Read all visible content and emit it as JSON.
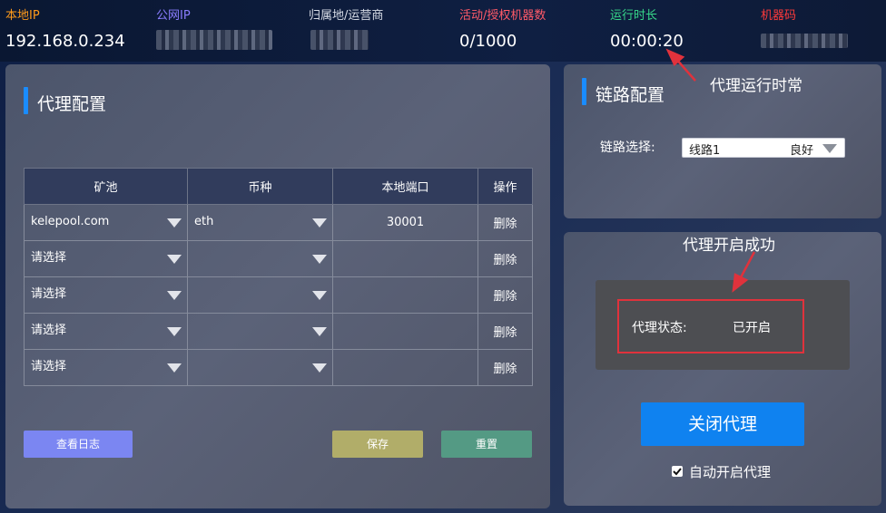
{
  "topbar": {
    "local_ip_label": "本地IP",
    "local_ip_value": "192.168.0.234",
    "public_ip_label": "公网IP",
    "location_label": "归属地/运营商",
    "machines_label": "活动/授权机器数",
    "machines_value": "0/1000",
    "uptime_label": "运行时长",
    "uptime_value": "00:00:20",
    "machine_code_label": "机器码",
    "colors": {
      "local_ip": "#ff9a1a",
      "public_ip": "#8a7dff",
      "location": "#d6dbe6",
      "machines": "#ff5a68",
      "uptime": "#37d98a",
      "machine_code": "#ff3a3a"
    }
  },
  "proxy_config": {
    "title": "代理配置",
    "columns": [
      "矿池",
      "币种",
      "本地端口",
      "操作"
    ],
    "rows": [
      {
        "pool": "kelepool.com",
        "coin": "eth",
        "port": "30001",
        "action": "删除"
      },
      {
        "pool": "请选择",
        "coin": "",
        "port": "",
        "action": "删除"
      },
      {
        "pool": "请选择",
        "coin": "",
        "port": "",
        "action": "删除"
      },
      {
        "pool": "请选择",
        "coin": "",
        "port": "",
        "action": "删除"
      },
      {
        "pool": "请选择",
        "coin": "",
        "port": "",
        "action": "删除"
      }
    ],
    "view_log_label": "查看日志",
    "save_label": "保存",
    "reset_label": "重置"
  },
  "link_config": {
    "title": "链路配置",
    "select_label": "链路选择:",
    "selected_line": "线路1",
    "line_status": "良好"
  },
  "proxy_status": {
    "status_label": "代理状态:",
    "status_value": "已开启",
    "close_button_label": "关闭代理",
    "auto_start_label": "自动开启代理",
    "auto_start_checked": true
  },
  "annotations": {
    "uptime_note": "代理运行时常",
    "success_note": "代理开启成功"
  }
}
